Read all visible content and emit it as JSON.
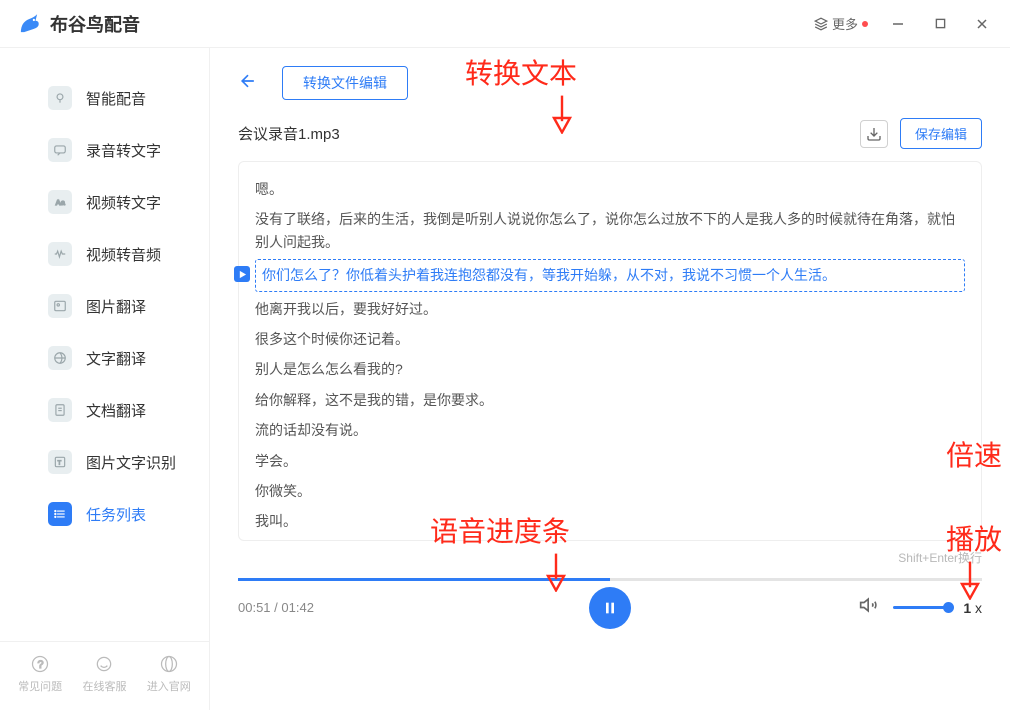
{
  "app": {
    "title": "布谷鸟配音",
    "more_label": "更多"
  },
  "sidebar": {
    "items": [
      {
        "label": "智能配音",
        "icon": "mic",
        "bg": "#e8eef0",
        "fg": "#9aa6aa"
      },
      {
        "label": "录音转文字",
        "icon": "chat",
        "bg": "#e8eef0",
        "fg": "#9aa6aa"
      },
      {
        "label": "视频转文字",
        "icon": "aa",
        "bg": "#e8eef0",
        "fg": "#9aa6aa"
      },
      {
        "label": "视频转音频",
        "icon": "waves",
        "bg": "#e8eef0",
        "fg": "#9aa6aa"
      },
      {
        "label": "图片翻译",
        "icon": "image",
        "bg": "#e8eef0",
        "fg": "#9aa6aa"
      },
      {
        "label": "文字翻译",
        "icon": "globe",
        "bg": "#e8eef0",
        "fg": "#9aa6aa"
      },
      {
        "label": "文档翻译",
        "icon": "doc",
        "bg": "#e8eef0",
        "fg": "#9aa6aa"
      },
      {
        "label": "图片文字识别",
        "icon": "ocr",
        "bg": "#e8eef0",
        "fg": "#9aa6aa"
      },
      {
        "label": "任务列表",
        "icon": "list",
        "bg": "#2e7cf6",
        "fg": "#ffffff"
      }
    ],
    "bottom": [
      {
        "label": "常见问题",
        "icon": "help"
      },
      {
        "label": "在线客服",
        "icon": "support"
      },
      {
        "label": "进入官网",
        "icon": "web"
      }
    ]
  },
  "content": {
    "edit_label": "转换文件编辑",
    "file_name": "会议录音1.mp3",
    "save_label": "保存编辑",
    "lines": [
      "嗯。",
      "没有了联络，后来的生活，我倒是听别人说说你怎么了，说你怎么过放不下的人是我人多的时候就待在角落，就怕别人问起我。",
      "你们怎么了？你低着头护着我连抱怨都没有，等我开始躲，从不对，我说不习惯一个人生活。",
      "他离开我以后，要我好好过。",
      "很多这个时候你还记着。",
      "别人是怎么怎么看我的?",
      "给你解释，这不是我的错，是你要求。",
      "流的话却没有说。",
      "学会。",
      "你微笑。",
      "我叫。"
    ],
    "selected_index": 2,
    "hint": "Shift+Enter换行"
  },
  "player": {
    "current": "00:51",
    "total": "01:42",
    "progress_pct": 50,
    "speed": "1",
    "speed_suffix": "x"
  },
  "annotations": {
    "a1": "转换文本",
    "a2": "语音进度条",
    "a3_line1": "倍速",
    "a3_line2": "播放"
  }
}
